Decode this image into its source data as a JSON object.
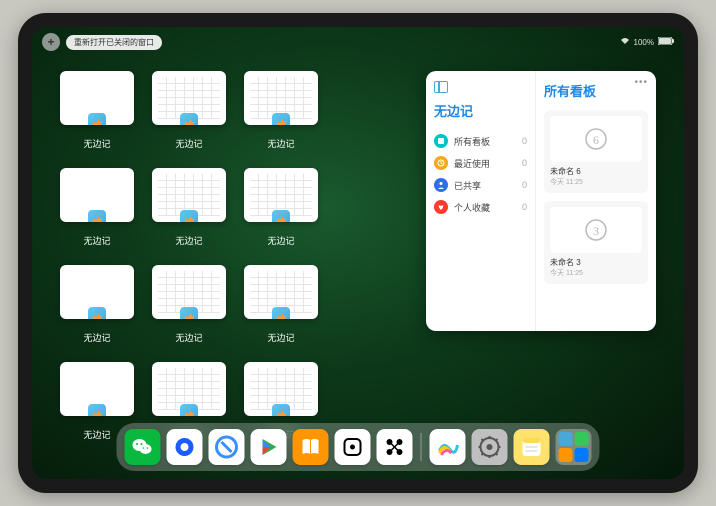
{
  "status": {
    "reopen_label": "重新打开已关闭的窗口",
    "battery": "100%"
  },
  "thumbnails": {
    "label": "无边记",
    "items": [
      {
        "variant": "blank"
      },
      {
        "variant": "calendar"
      },
      {
        "variant": "calendar"
      },
      {
        "variant": "blank"
      },
      {
        "variant": "calendar"
      },
      {
        "variant": "calendar"
      },
      {
        "variant": "blank"
      },
      {
        "variant": "calendar"
      },
      {
        "variant": "calendar"
      },
      {
        "variant": "blank"
      },
      {
        "variant": "calendar"
      },
      {
        "variant": "calendar"
      }
    ]
  },
  "panel": {
    "left_title": "无边记",
    "right_title": "所有看板",
    "more": "•••",
    "items": [
      {
        "label": "所有看板",
        "count": "0",
        "color": "#00c2c7",
        "icon": "box"
      },
      {
        "label": "最近使用",
        "count": "0",
        "color": "#f5a623",
        "icon": "clock"
      },
      {
        "label": "已共享",
        "count": "0",
        "color": "#2f6fed",
        "icon": "person"
      },
      {
        "label": "个人收藏",
        "count": "0",
        "color": "#ff3b30",
        "icon": "heart"
      }
    ],
    "boards": [
      {
        "name": "未命名 6",
        "date": "今天 11:25",
        "glyph": "6"
      },
      {
        "name": "未命名 3",
        "date": "今天 11:25",
        "glyph": "3"
      }
    ]
  },
  "dock": {
    "icons": [
      {
        "name": "wechat",
        "bg": "#09b83e"
      },
      {
        "name": "qqbrowser",
        "bg": "#ffffff"
      },
      {
        "name": "uc",
        "bg": "#ffffff"
      },
      {
        "name": "play",
        "bg": "#ffffff"
      },
      {
        "name": "books",
        "bg": "#ff9500"
      },
      {
        "name": "dice",
        "bg": "#ffffff"
      },
      {
        "name": "connect",
        "bg": "#ffffff"
      },
      {
        "name": "freeform",
        "bg": "#ffffff"
      },
      {
        "name": "settings",
        "bg": "#bfbfbf"
      },
      {
        "name": "notes",
        "bg": "#ffe26b"
      }
    ]
  }
}
